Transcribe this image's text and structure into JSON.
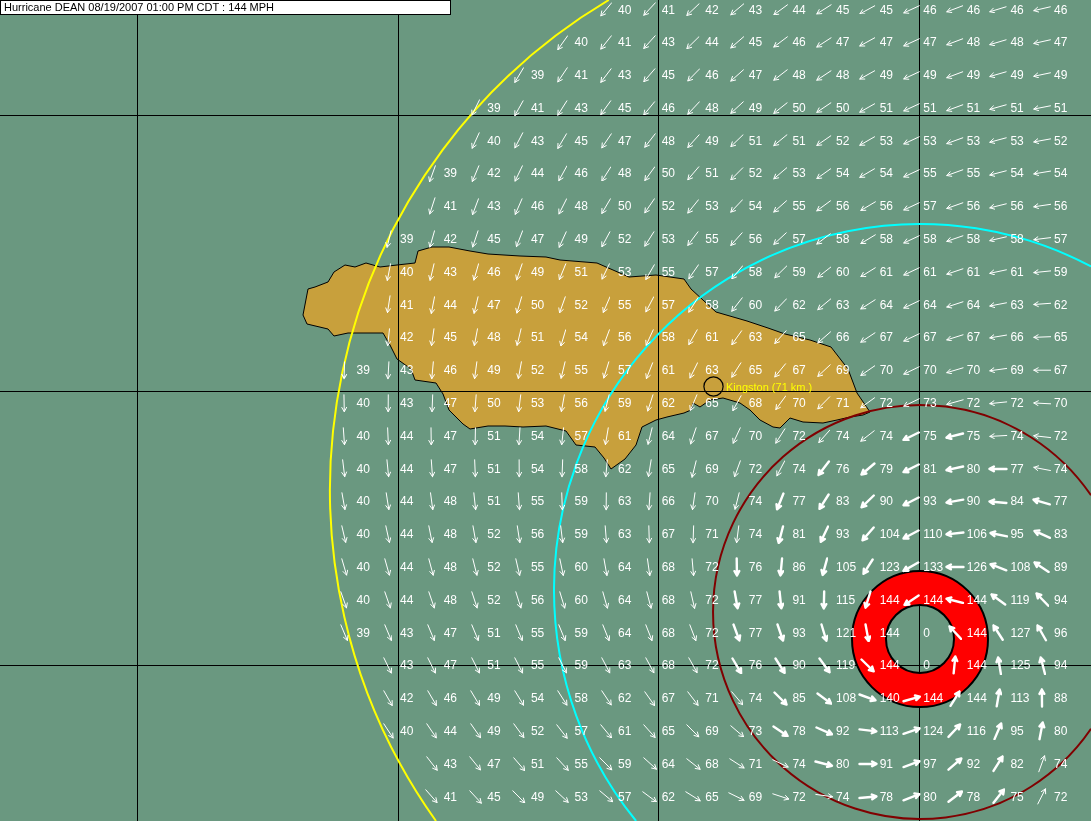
{
  "title": "Hurricane DEAN 08/19/2007 01:00 PM CDT : 144 MPH",
  "wind_radii": [
    {
      "kind": "circle",
      "color": "#ffff00"
    },
    {
      "kind": "circle",
      "color": "#00ffff"
    },
    {
      "kind": "circle",
      "color": "#800000"
    },
    {
      "kind": "ring",
      "color": "#ff0000"
    }
  ],
  "cities": [
    {
      "label": "Kingston (71 km.)"
    }
  ],
  "wind_field": {
    "rows": [
      [
        null,
        null,
        null,
        null,
        null,
        null,
        "40",
        "41",
        "42",
        "43",
        "44",
        "45",
        "45",
        "46",
        "46",
        "46",
        "46"
      ],
      [
        null,
        null,
        null,
        null,
        null,
        "40",
        "41",
        "43",
        "44",
        "45",
        "46",
        "47",
        "47",
        "47",
        "48",
        "48",
        "47"
      ],
      [
        null,
        null,
        null,
        null,
        "39",
        "41",
        "43",
        "45",
        "46",
        "47",
        "48",
        "48",
        "49",
        "49",
        "49",
        "49",
        "49"
      ],
      [
        null,
        null,
        null,
        "39",
        "41",
        "43",
        "45",
        "46",
        "48",
        "49",
        "50",
        "50",
        "51",
        "51",
        "51",
        "51",
        "51"
      ],
      [
        null,
        null,
        null,
        "40",
        "43",
        "45",
        "47",
        "48",
        "49",
        "51",
        "51",
        "52",
        "53",
        "53",
        "53",
        "53",
        "52"
      ],
      [
        null,
        null,
        "39",
        "42",
        "44",
        "46",
        "48",
        "50",
        "51",
        "52",
        "53",
        "54",
        "54",
        "55",
        "55",
        "54",
        "54"
      ],
      [
        null,
        null,
        "41",
        "43",
        "46",
        "48",
        "50",
        "52",
        "53",
        "54",
        "55",
        "56",
        "56",
        "57",
        "56",
        "56",
        "56"
      ],
      [
        null,
        "39",
        "42",
        "45",
        "47",
        "49",
        "52",
        "53",
        "55",
        "56",
        "57",
        "58",
        "58",
        "58",
        "58",
        "58",
        "57"
      ],
      [
        null,
        "40",
        "43",
        "46",
        "49",
        "51",
        "53",
        "55",
        "57",
        "58",
        "59",
        "60",
        "61",
        "61",
        "61",
        "61",
        "59"
      ],
      [
        null,
        "41",
        "44",
        "47",
        "50",
        "52",
        "55",
        "57",
        "58",
        "60",
        "62",
        "63",
        "64",
        "64",
        "64",
        "63",
        "62"
      ],
      [
        null,
        "42",
        "45",
        "48",
        "51",
        "54",
        "56",
        "58",
        "61",
        "63",
        "65",
        "66",
        "67",
        "67",
        "67",
        "66",
        "65"
      ],
      [
        "39",
        "43",
        "46",
        "49",
        "52",
        "55",
        "57",
        "61",
        "63",
        "65",
        "67",
        "69",
        "70",
        "70",
        "70",
        "69",
        "67"
      ],
      [
        "40",
        "43",
        "47",
        "50",
        "53",
        "56",
        "59",
        "62",
        "65",
        "68",
        "70",
        "71",
        "72",
        "73",
        "72",
        "72",
        "70"
      ],
      [
        "40",
        "44",
        "47",
        "51",
        "54",
        "57",
        "61",
        "64",
        "67",
        "70",
        "72",
        "74",
        "74",
        "75",
        "75",
        "74",
        "72"
      ],
      [
        "40",
        "44",
        "47",
        "51",
        "54",
        "58",
        "62",
        "65",
        "69",
        "72",
        "74",
        "76",
        "79",
        "81",
        "80",
        "77",
        "74"
      ],
      [
        "40",
        "44",
        "48",
        "51",
        "55",
        "59",
        "63",
        "66",
        "70",
        "74",
        "77",
        "83",
        "90",
        "93",
        "90",
        "84",
        "77"
      ],
      [
        "40",
        "44",
        "48",
        "52",
        "56",
        "59",
        "63",
        "67",
        "71",
        "74",
        "81",
        "93",
        "104",
        "110",
        "106",
        "95",
        "83"
      ],
      [
        "40",
        "44",
        "48",
        "52",
        "55",
        "60",
        "64",
        "68",
        "72",
        "76",
        "86",
        "105",
        "123",
        "133",
        "126",
        "108",
        "89"
      ],
      [
        "40",
        "44",
        "48",
        "52",
        "56",
        "60",
        "64",
        "68",
        "72",
        "77",
        "91",
        "115",
        "144",
        "144",
        "144",
        "119",
        "94"
      ],
      [
        "39",
        "43",
        "47",
        "51",
        "55",
        "59",
        "64",
        "68",
        "72",
        "77",
        "93",
        "121",
        "144",
        "0",
        "144",
        "127",
        "96"
      ],
      [
        null,
        "43",
        "47",
        "51",
        "55",
        "59",
        "63",
        "68",
        "72",
        "76",
        "90",
        "119",
        "144",
        "0",
        "144",
        "125",
        "94"
      ],
      [
        null,
        "42",
        "46",
        "49",
        "54",
        "58",
        "62",
        "67",
        "71",
        "74",
        "85",
        "108",
        "140",
        "144",
        "144",
        "113",
        "88"
      ],
      [
        null,
        "40",
        "44",
        "49",
        "52",
        "57",
        "61",
        "65",
        "69",
        "73",
        "78",
        "92",
        "113",
        "124",
        "116",
        "95",
        "80"
      ],
      [
        null,
        null,
        "43",
        "47",
        "51",
        "55",
        "59",
        "64",
        "68",
        "71",
        "74",
        "80",
        "91",
        "97",
        "92",
        "82",
        "74"
      ],
      [
        null,
        null,
        "41",
        "45",
        "49",
        "53",
        "57",
        "62",
        "65",
        "69",
        "72",
        "74",
        "78",
        "80",
        "78",
        "75",
        "72"
      ]
    ]
  }
}
